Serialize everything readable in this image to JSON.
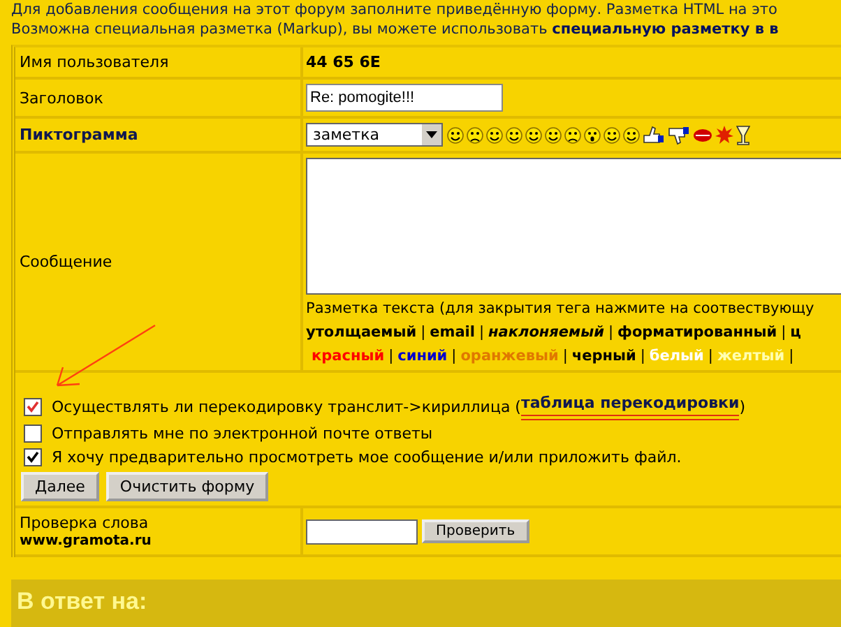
{
  "intro": [
    "Для добавления сообщения на этот форум заполните приведённую форму. Разметка HTML на это",
    "Возможна специальная разметка (Markup), вы можете использовать **специальную разметку в в**"
  ],
  "form": {
    "username": {
      "label": "Имя пользователя",
      "value": "44 65 6E"
    },
    "subject": {
      "label": "Заголовок",
      "value": "Re: pomogite!!!"
    },
    "icon": {
      "label": "Пиктограмма",
      "select_value": "заметка"
    },
    "message": {
      "label": "Сообщение",
      "markup_hint": "Разметка текста (для закрытия тега нажмите на соотвествующу",
      "separator": "|",
      "markup_tags": [
        {
          "label": "утолщаемый",
          "kind": "bold"
        },
        {
          "label": "email",
          "kind": "bold"
        },
        {
          "label": "наклоняемый",
          "kind": "italic"
        },
        {
          "label": "форматированный",
          "kind": "bold"
        },
        {
          "label": "ц",
          "kind": "bold"
        }
      ],
      "color_tags": [
        {
          "label": "красный",
          "color": "#ff0000"
        },
        {
          "label": "синий",
          "color": "#0000cc"
        },
        {
          "label": "оранжевый",
          "color": "#e07800"
        },
        {
          "label": "черный",
          "color": "#000000"
        },
        {
          "label": "белый",
          "color": "#ffffff"
        },
        {
          "label": "желтый",
          "color": "#ffffb0"
        }
      ]
    },
    "options": [
      {
        "label": "Осуществлять ли перекодировку транслит->кириллица (",
        "link": "таблица перекодировки",
        "after": ")",
        "checked": true
      },
      {
        "label": "Отправлять мне по электронной почте ответы",
        "checked": false
      },
      {
        "label": "Я хочу предварительно просмотреть мое сообщение и/или приложить файл.",
        "checked": true
      }
    ],
    "buttons": [
      "Далее",
      "Очистить форму"
    ],
    "word_check": {
      "label": "Проверка слова",
      "site": "www.gramota.ru",
      "button": "Проверить"
    }
  },
  "reply_heading": "В ответ на:"
}
